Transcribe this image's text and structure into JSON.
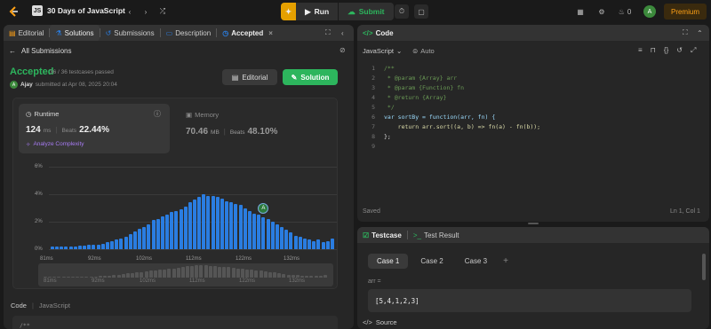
{
  "topbar": {
    "title": "30 Days of JavaScript",
    "run_label": "Run",
    "submit_label": "Submit",
    "notif_count": "0",
    "avatar_initial": "A",
    "premium_label": "Premium"
  },
  "left": {
    "tabs": [
      "Editorial",
      "Solutions",
      "Submissions",
      "Description",
      "Accepted"
    ],
    "back_label": "All Submissions",
    "status": "Accepted",
    "testcases": "36 / 36 testcases passed",
    "user": "Ajay",
    "submitted": "submitted at Apr 08, 2025 20:04",
    "editorial_btn": "Editorial",
    "solution_btn": "Solution",
    "runtime_label": "Runtime",
    "runtime_value": "124",
    "runtime_unit": "ms",
    "beats_label": "Beats",
    "runtime_beats": "22.44%",
    "analyze_label": "Analyze Complexity",
    "memory_label": "Memory",
    "memory_value": "70.46",
    "memory_unit": "MB",
    "memory_beats": "48.10%",
    "code_label": "Code",
    "code_lang": "JavaScript",
    "code_first": "/**"
  },
  "chart_data": {
    "type": "bar",
    "y_ticks": [
      "6%",
      "4%",
      "2%",
      "0%"
    ],
    "ylim": [
      0,
      6
    ],
    "x_ticks": [
      "81ms",
      "92ms",
      "102ms",
      "112ms",
      "122ms",
      "132ms"
    ],
    "values": [
      0.2,
      0.2,
      0.2,
      0.2,
      0.2,
      0.2,
      0.25,
      0.25,
      0.3,
      0.3,
      0.35,
      0.4,
      0.5,
      0.6,
      0.7,
      0.8,
      0.9,
      1.1,
      1.3,
      1.5,
      1.6,
      1.8,
      2.1,
      2.2,
      2.4,
      2.5,
      2.7,
      2.8,
      2.9,
      3.1,
      3.4,
      3.6,
      3.8,
      4.0,
      3.9,
      3.9,
      3.8,
      3.7,
      3.5,
      3.4,
      3.3,
      3.2,
      3.0,
      2.8,
      2.6,
      2.5,
      2.3,
      2.2,
      2.0,
      1.8,
      1.6,
      1.4,
      1.2,
      1.0,
      0.9,
      0.8,
      0.7,
      0.6,
      0.7,
      0.5,
      0.6,
      0.8
    ],
    "marker_label": "A",
    "bar_color": "#2a7de1"
  },
  "right": {
    "code_title": "Code",
    "language": "JavaScript",
    "auto_label": "Auto",
    "line_numbers": [
      "1",
      "2",
      "3",
      "4",
      "5",
      "6",
      "7",
      "8",
      "9"
    ],
    "lines": [
      "/**",
      " * @param {Array} arr",
      " * @param {Function} fn",
      " * @return {Array}",
      " */",
      "var sortBy = function(arr, fn) {",
      "    return arr.sort((a, b) => fn(a) - fn(b));",
      "};",
      ""
    ],
    "saved_label": "Saved",
    "cursor_pos": "Ln 1, Col 1",
    "testcase_tab": "Testcase",
    "result_tab": "Test Result",
    "cases": [
      "Case 1",
      "Case 2",
      "Case 3"
    ],
    "arr_label": "arr =",
    "arr_value": "[5,4,1,2,3]",
    "source_label": "Source"
  }
}
